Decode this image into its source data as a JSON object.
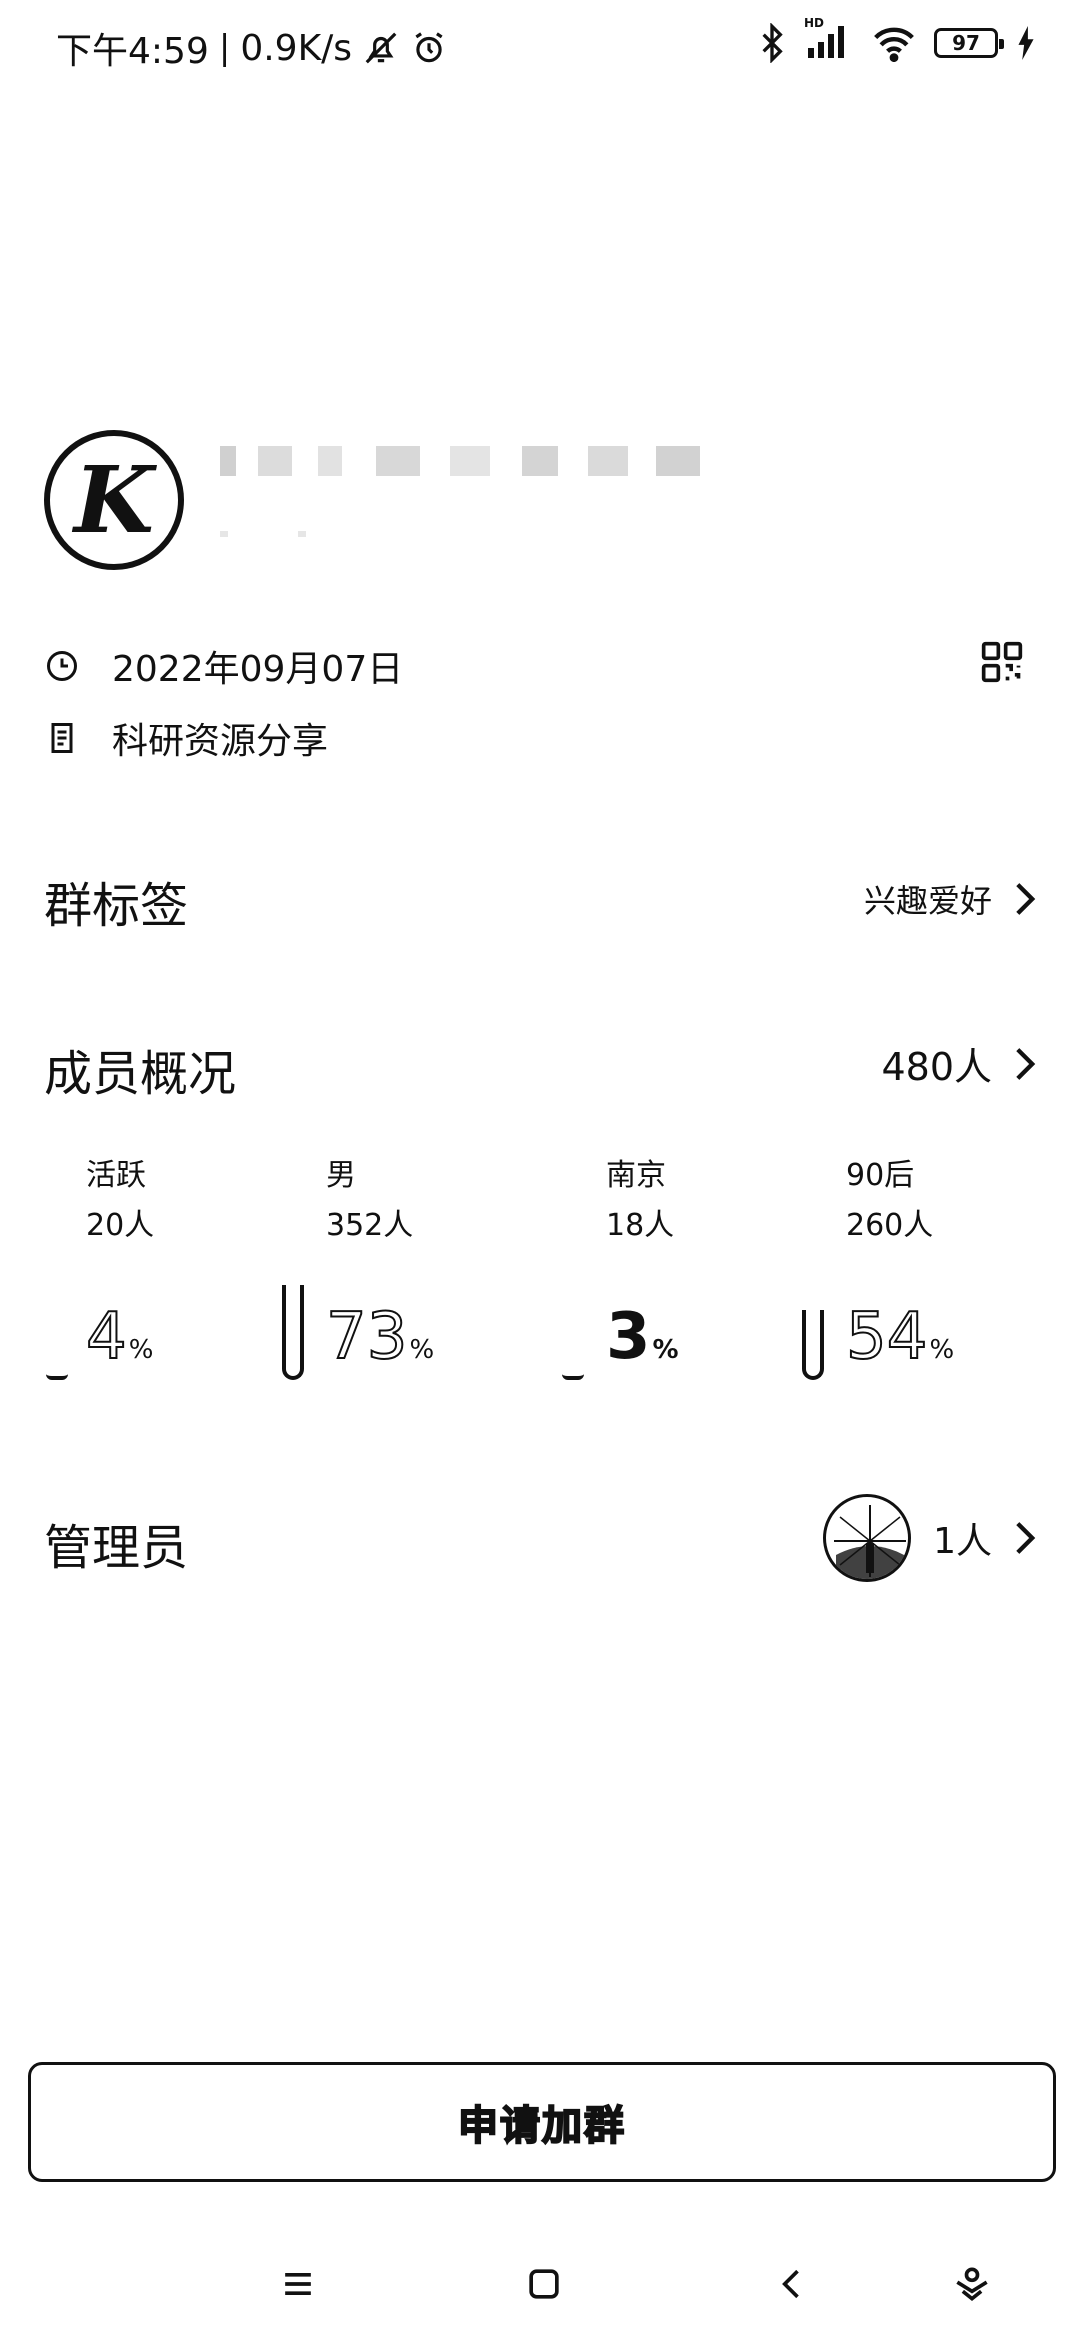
{
  "status_bar": {
    "time": "下午4:59",
    "divider": "|",
    "net_speed": "0.9K/s",
    "battery": "97",
    "signal_badge": "HD"
  },
  "group": {
    "avatar_letter": "K"
  },
  "info": {
    "date": "2022年09月07日",
    "description": "科研资源分享"
  },
  "tags": {
    "title": "群标签",
    "value": "兴趣爱好"
  },
  "members": {
    "title": "成员概况",
    "total": "480人",
    "stats": [
      {
        "label": "活跃",
        "count": "20人",
        "percent": "4",
        "fill": 0.04
      },
      {
        "label": "男",
        "count": "352人",
        "percent": "73",
        "fill": 0.73
      },
      {
        "label": "南京",
        "count": "18人",
        "percent": "3",
        "fill": 0.03
      },
      {
        "label": "90后",
        "count": "260人",
        "percent": "54",
        "fill": 0.54
      }
    ],
    "percent_unit": "%"
  },
  "admins": {
    "title": "管理员",
    "count": "1人"
  },
  "join_button": {
    "label": "申请加群"
  },
  "colors": {
    "ink": "#111111",
    "background": "#ffffff",
    "muted": "#d6d6d6"
  }
}
